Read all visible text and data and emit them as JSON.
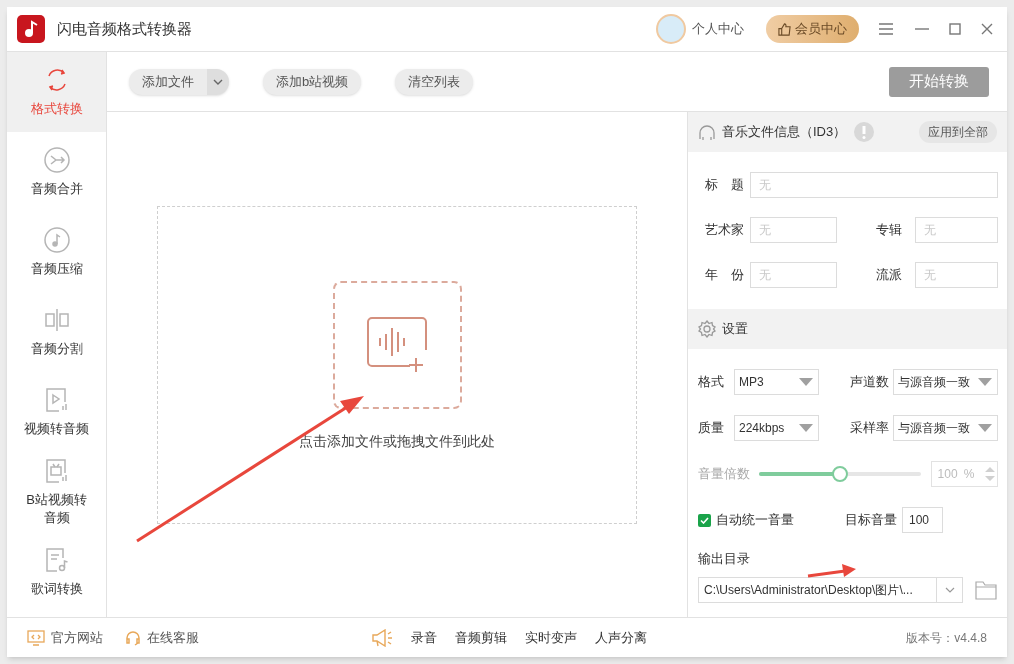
{
  "window": {
    "title": "闪电音频格式转换器"
  },
  "header": {
    "user_label": "个人中心",
    "vip_button": "会员中心"
  },
  "sidebar": {
    "items": [
      {
        "label": "格式转换",
        "selected": true
      },
      {
        "label": "音频合并",
        "selected": false
      },
      {
        "label": "音频压缩",
        "selected": false
      },
      {
        "label": "音频分割",
        "selected": false
      },
      {
        "label": "视频转音频",
        "selected": false
      },
      {
        "label": "B站视频转音频",
        "selected": false
      },
      {
        "label": "歌词转换",
        "selected": false
      }
    ]
  },
  "toolbar": {
    "buttons": [
      {
        "label": "添加文件",
        "kind": "split"
      },
      {
        "label": "添加b站视频",
        "kind": "plain"
      },
      {
        "label": "清空列表",
        "kind": "plain"
      }
    ],
    "start_button": "开始转换"
  },
  "dropzone": {
    "text": "点击添加文件或拖拽文件到此处"
  },
  "id3": {
    "title": "音乐文件信息（ID3）",
    "apply_button": "应用到全部",
    "rows": [
      [
        {
          "label": "标　题",
          "placeholder": "无"
        }
      ],
      [
        {
          "label": "艺术家",
          "placeholder": "无"
        },
        {
          "label": "专辑",
          "placeholder": "无"
        }
      ],
      [
        {
          "label": "年　份",
          "placeholder": "无"
        },
        {
          "label": "流派",
          "placeholder": "无"
        }
      ]
    ]
  },
  "settings": {
    "title": "设置",
    "selects": [
      [
        {
          "label": "格式",
          "value": "MP3"
        },
        {
          "label": "声道数",
          "value": "与源音频一致"
        }
      ],
      [
        {
          "label": "质量",
          "value": "224kbps"
        },
        {
          "label": "采样率",
          "value": "与源音频一致"
        }
      ]
    ],
    "volume": {
      "label": "音量倍数",
      "level": 0.5,
      "value": "100",
      "unit": "%",
      "disabled": true
    },
    "auto_volume": {
      "label": "自动统一音量",
      "checked": true
    },
    "target_volume": {
      "label": "目标音量",
      "value": "100"
    },
    "output": {
      "label": "输出目录",
      "path": "C:\\Users\\Administrator\\Desktop\\图片\\..."
    }
  },
  "footer": {
    "links": [
      "官方网站",
      "在线客服"
    ],
    "tools": [
      "录音",
      "音频剪辑",
      "实时变声",
      "人声分离"
    ],
    "version": "版本号：v4.4.8"
  }
}
